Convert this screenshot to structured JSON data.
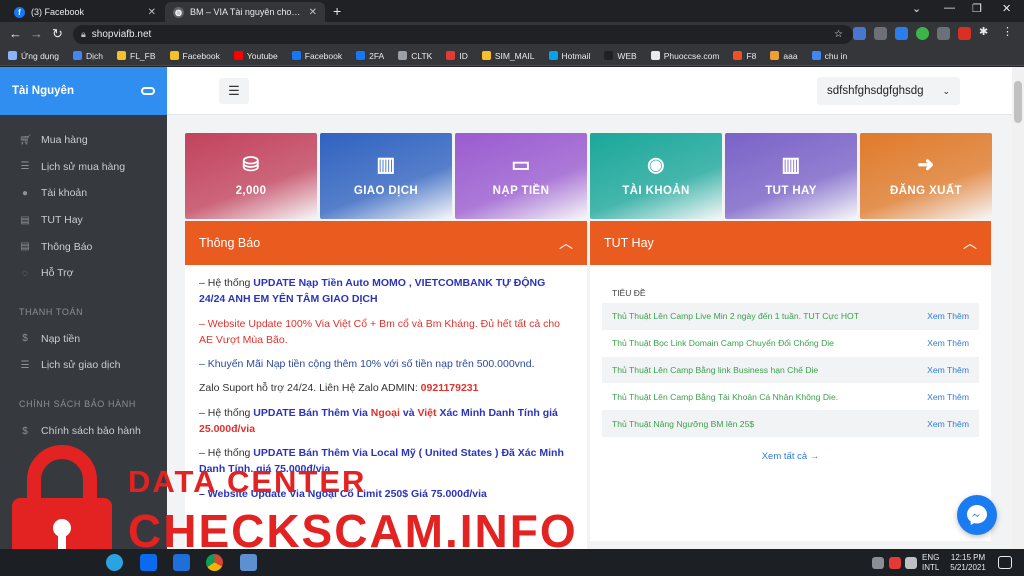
{
  "browser": {
    "tabs": [
      {
        "title": "(3) Facebook",
        "active": false,
        "icon": "facebook-icon"
      },
      {
        "title": "BM – VIA Tài nguyên cho mạng x",
        "active": true,
        "icon": "globe-icon"
      }
    ],
    "url": "shopviafb.net",
    "bookmarks": [
      {
        "label": "Ứng dụng",
        "color": "#8ab4f8"
      },
      {
        "label": "Dịch",
        "color": "#4285f4"
      },
      {
        "label": "FL_FB",
        "color": "#f6c026"
      },
      {
        "label": "Facebook",
        "color": "#f6c026"
      },
      {
        "label": "Youtube",
        "color": "#ff0000"
      },
      {
        "label": "Facebook",
        "color": "#1877f2"
      },
      {
        "label": "2FA",
        "color": "#1877f2"
      },
      {
        "label": "CLTK",
        "color": "#9aa0a6"
      },
      {
        "label": "ID",
        "color": "#e53935"
      },
      {
        "label": "SIM_MAIL",
        "color": "#f6c026"
      },
      {
        "label": "Hotmail",
        "color": "#00a4ef"
      },
      {
        "label": "WEB",
        "color": "#202124"
      },
      {
        "label": "Phuoccse.com",
        "color": "#e8eaed"
      },
      {
        "label": "F8",
        "color": "#f05123"
      },
      {
        "label": "aaa",
        "color": "#f0a030"
      },
      {
        "label": "chu in",
        "color": "#4285f4"
      }
    ]
  },
  "sidebar": {
    "brand": "Tài Nguyên",
    "items": [
      {
        "label": "Mua hàng",
        "icon": "cart-icon"
      },
      {
        "label": "Lịch sử mua hàng",
        "icon": "list-icon"
      },
      {
        "label": "Tài khoản",
        "icon": "user-icon"
      },
      {
        "label": "TUT Hay",
        "icon": "document-icon"
      },
      {
        "label": "Thông Báo",
        "icon": "document-icon"
      },
      {
        "label": "Hỗ Trợ",
        "icon": "chat-icon"
      }
    ],
    "section_payment": "THANH TOÁN",
    "payment_items": [
      {
        "label": "Nạp tiền",
        "icon": "dollar-icon"
      },
      {
        "label": "Lịch sử giao dịch",
        "icon": "list-icon"
      }
    ],
    "section_warranty": "CHÍNH SÁCH BẢO HÀNH",
    "warranty_items": [
      {
        "label": "Chính sách bảo hành",
        "icon": "dollar-icon"
      }
    ]
  },
  "header": {
    "username": "sdfshfghsdgfghsdg"
  },
  "tiles": [
    {
      "label": "2,000",
      "icon": "coins-icon",
      "color": "#c2425c"
    },
    {
      "label": "GIAO DỊCH",
      "icon": "bar-chart-icon",
      "color": "#2f62c0"
    },
    {
      "label": "NẠP TIỀN",
      "icon": "credit-card-icon",
      "color": "#9a5bd0"
    },
    {
      "label": "TÀI KHOẢN",
      "icon": "user-circle-icon",
      "color": "#1aa79a"
    },
    {
      "label": "TUT HAY",
      "icon": "bar-chart-icon",
      "color": "#7a62c8"
    },
    {
      "label": "ĐĂNG XUẤT",
      "icon": "logout-icon",
      "color": "#e07a2a"
    }
  ],
  "notice": {
    "title": "Thông Báo",
    "p1_a": "– Hệ thống ",
    "p1_b": "UPDATE Nạp Tiền Auto MOMO , VIETCOMBANK TỰ ĐỘNG 24/24 ANH EM YÊN TÂM GIAO DỊCH",
    "p2": "– Website Update 100% Via Việt Cổ + Bm cổ và Bm Kháng. Đủ hết tất cả cho AE Vượt Mùa Bão.",
    "p3": "– Khuyến Mãi Nạp tiền cộng thêm 10% với số tiền nạp trên 500.000vnd.",
    "p4_a": "Zalo Suport hỗ trợ 24/24. Liên Hệ Zalo ADMIN: ",
    "p4_b": "0921179231",
    "p5_a": "– Hệ thống ",
    "p5_b": "UPDATE Bán Thêm Via ",
    "p5_c": "Ngoại",
    "p5_d": " và ",
    "p5_e": "Việt",
    "p5_f": " Xác Minh Danh Tính giá ",
    "p5_g": "25.000đ/via",
    "p6_a": "– Hệ thống ",
    "p6_b": "UPDATE Bán Thêm Via Local Mỹ ( United States ) Đã Xác Minh Danh Tính. giá 75.000đ/via",
    "p7": "– Website Update Via Ngoại Cổ Limit 250$ Giá 75.000đ/via"
  },
  "tut": {
    "title": "TUT Hay",
    "column": "TIÊU ĐỀ",
    "rows": [
      {
        "title": "Thủ Thuật Lên Camp Live Min 2 ngày đến 1 tuần. TUT Cực HOT",
        "more": "Xem Thêm"
      },
      {
        "title": "Thủ Thuật Bọc Link Domain Camp Chuyển Đổi Chống Die",
        "more": "Xem Thêm"
      },
      {
        "title": "Thủ Thuật Lên Camp Bằng link Business hạn Chế Die",
        "more": "Xem Thêm"
      },
      {
        "title": "Thủ Thuật Lên Camp Bằng Tài Khoản Cá Nhân Không Die.",
        "more": "Xem Thêm"
      },
      {
        "title": "Thủ Thuật Nâng Ngưỡng BM lên 25$",
        "more": "Xem Thêm"
      }
    ],
    "view_all": "Xem tất cả"
  },
  "watermark": {
    "line1": "DATA CENTER",
    "line2": "CHECKSCAM.INFO"
  },
  "taskbar": {
    "lang": "ENG",
    "layout": "INTL",
    "time": "12:15 PM",
    "date": "5/21/2021"
  }
}
